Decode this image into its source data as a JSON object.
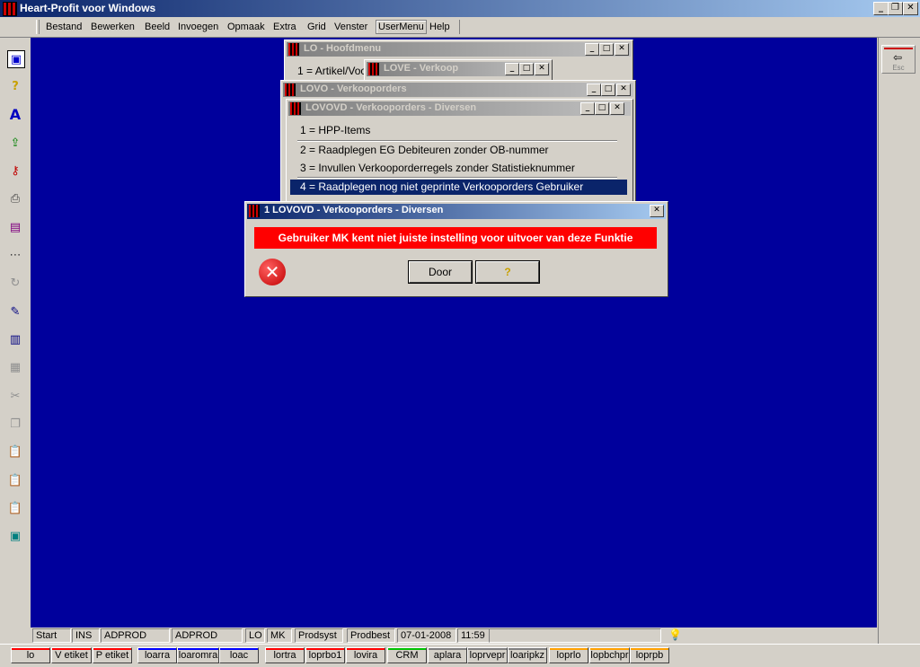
{
  "app": {
    "title": "Heart-Profit voor Windows",
    "window_buttons": {
      "minimize": "_",
      "restore": "❐",
      "close": "✕"
    }
  },
  "menu": {
    "items": [
      "Bestand",
      "Bewerken",
      "Beeld",
      "Invoegen",
      "Opmaak",
      "Extra",
      "Grid",
      "Venster",
      "UserMenu",
      "Help"
    ],
    "selected": "UserMenu"
  },
  "right_panel": {
    "esc_label": "Esc"
  },
  "windows": {
    "hoofdmenu": {
      "title": "LO - Hoofdmenu",
      "first_item": "1 = Artikel/Voo"
    },
    "verkoop": {
      "title": "LOVE - Verkoop"
    },
    "verkooporders": {
      "title": "LOVO - Verkooporders"
    },
    "diversen": {
      "title": "LOVOVD - Verkooporders - Diversen",
      "items": [
        "1 = HPP-Items",
        "2 = Raadplegen EG Debiteuren zonder OB-nummer",
        "3 = Invullen Verkooporderregels zonder Statistieknummer",
        "4 = Raadplegen nog niet geprinte Verkooporders Gebruiker"
      ],
      "selected_index": 3
    }
  },
  "error_dialog": {
    "title": "1 LOVOVD - Verkooporders - Diversen",
    "message": "Gebruiker MK kent niet juiste instelling voor uitvoer van deze Funktie",
    "ok_label": "Door",
    "help_label": "?"
  },
  "statusbar": {
    "cells": [
      "Start",
      "INS",
      "ADPROD",
      "ADPROD",
      "LO",
      "MK",
      "Prodsyst",
      "Prodbest",
      "07-01-2008",
      "11:59"
    ]
  },
  "taskbar": {
    "tasks": [
      {
        "label": "lo",
        "color": "#ff0000"
      },
      {
        "label": "V etiket",
        "color": "#ff0000"
      },
      {
        "label": "P etiket",
        "color": "#ff0000"
      },
      {
        "label": "loarra",
        "color": "#0000ff"
      },
      {
        "label": "loaromra",
        "color": "#0000ff"
      },
      {
        "label": "loac",
        "color": "#0000ff"
      },
      {
        "label": "lortra",
        "color": "#ff0000"
      },
      {
        "label": "loprbo1",
        "color": "#ff0000"
      },
      {
        "label": "lovira",
        "color": "#ff0000"
      },
      {
        "label": "CRM",
        "color": "#00c000"
      },
      {
        "label": "aplara",
        "color": "#808080"
      },
      {
        "label": "loprvepr",
        "color": "#808080"
      },
      {
        "label": "loaripkz",
        "color": "#808080"
      },
      {
        "label": "loprlo",
        "color": "#ffa000"
      },
      {
        "label": "lopbchpr",
        "color": "#ffa000"
      },
      {
        "label": "loprpb",
        "color": "#ffa000"
      }
    ]
  },
  "toolbar_icons": [
    "window-icon",
    "help-icon",
    "font-icon",
    "export-icon",
    "key-icon",
    "print-icon",
    "form-icon",
    "dots-icon",
    "refresh-icon",
    "edit-icon",
    "chart-icon",
    "grid-icon",
    "cut-icon",
    "copy-icon",
    "paste-icon",
    "paste-special-icon",
    "paste-link-icon",
    "screen-icon"
  ]
}
